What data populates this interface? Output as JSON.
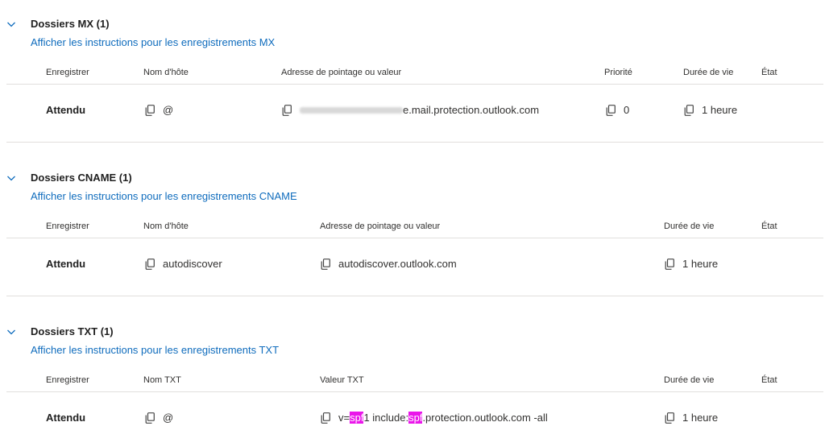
{
  "mx": {
    "title": "Dossiers MX (1)",
    "link": "Afficher les instructions pour les enregistrements MX",
    "headers": {
      "register": "Enregistrer",
      "host": "Nom d'hôte",
      "address": "Adresse de pointage ou valeur",
      "priority": "Priorité",
      "ttl": "Durée de vie",
      "state": "État"
    },
    "row": {
      "status": "Attendu",
      "host": "@",
      "address_suffix": "e.mail.protection.outlook.com",
      "priority": "0",
      "ttl": "1 heure"
    }
  },
  "cname": {
    "title": "Dossiers CNAME (1)",
    "link": "Afficher les instructions pour les enregistrements CNAME",
    "headers": {
      "register": "Enregistrer",
      "host": "Nom d'hôte",
      "address": "Adresse de pointage ou valeur",
      "ttl": "Durée de vie",
      "state": "État"
    },
    "row": {
      "status": "Attendu",
      "host": "autodiscover",
      "address": "autodiscover.outlook.com",
      "ttl": "1 heure"
    }
  },
  "txt": {
    "title": "Dossiers TXT (1)",
    "link": "Afficher les instructions pour les enregistrements TXT",
    "headers": {
      "register": "Enregistrer",
      "name": "Nom TXT",
      "value": "Valeur TXT",
      "ttl": "Durée de vie",
      "state": "État"
    },
    "row": {
      "status": "Attendu",
      "name": "@",
      "value_parts": [
        "v=",
        "spf",
        "1 include:",
        "spf",
        ".protection.outlook.com -all"
      ],
      "ttl": "1 heure"
    }
  },
  "icons": {
    "chevron": "chevron-down-icon",
    "copy": "copy-icon"
  },
  "colors": {
    "link": "#0f6cbd",
    "highlight": "#ea16ea",
    "divider": "#e1dfdd"
  }
}
